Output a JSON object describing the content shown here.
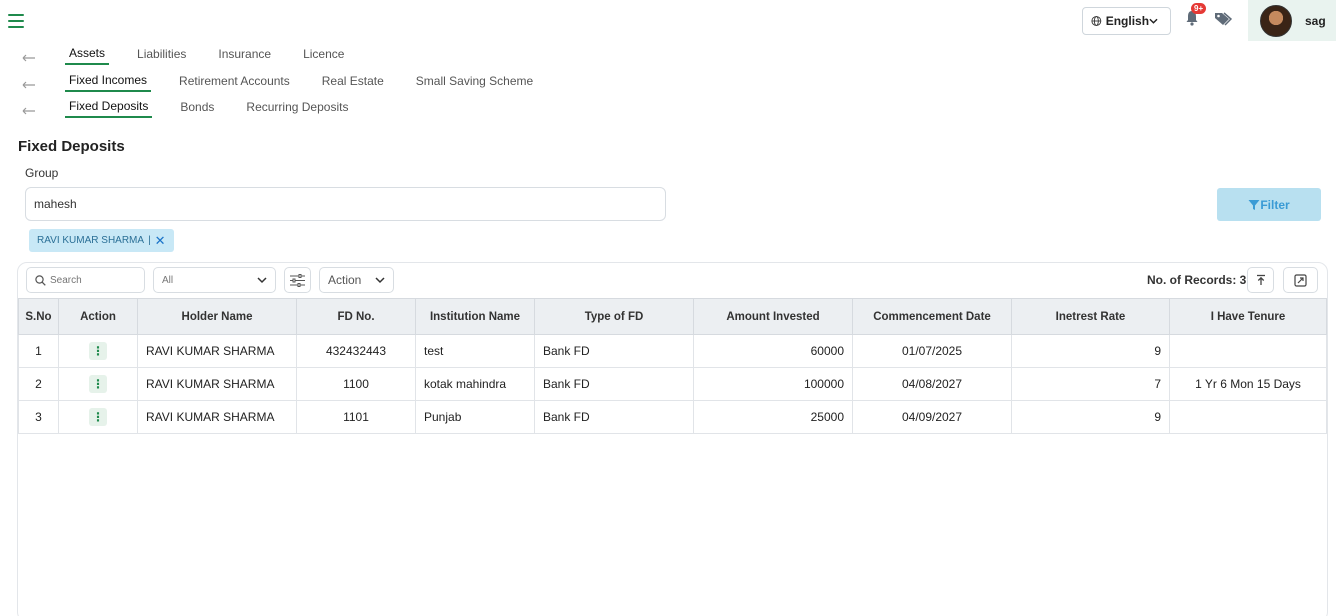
{
  "header": {
    "language": "English",
    "notification_badge": "9+",
    "username": "sag"
  },
  "nav": {
    "row1": [
      {
        "label": "Assets",
        "active": true
      },
      {
        "label": "Liabilities"
      },
      {
        "label": "Insurance"
      },
      {
        "label": "Licence"
      }
    ],
    "row2": [
      {
        "label": "Fixed Incomes",
        "active": true
      },
      {
        "label": "Retirement Accounts"
      },
      {
        "label": "Real Estate"
      },
      {
        "label": "Small Saving Scheme"
      }
    ],
    "row3": [
      {
        "label": "Fixed Deposits",
        "active": true
      },
      {
        "label": "Bonds"
      },
      {
        "label": "Recurring Deposits"
      }
    ]
  },
  "page_title": "Fixed Deposits",
  "group": {
    "label": "Group",
    "value": "mahesh"
  },
  "filter_label": "Filter",
  "chip": {
    "label": "RAVI KUMAR SHARMA",
    "sep": "|"
  },
  "toolbar": {
    "search_placeholder": "Search",
    "select_value": "All",
    "action_label": "Action",
    "records_label": "No. of Records: 3"
  },
  "table": {
    "headers": [
      "S.No",
      "Action",
      "Holder Name",
      "FD No.",
      "Institution Name",
      "Type of FD",
      "Amount Invested",
      "Commencement Date",
      "Inetrest Rate",
      "I Have Tenure"
    ],
    "rows": [
      [
        "1",
        "⋮",
        "RAVI KUMAR SHARMA",
        "432432443",
        "test",
        "Bank FD",
        "60000",
        "01/07/2025",
        "9",
        ""
      ],
      [
        "2",
        "⋮",
        "RAVI KUMAR SHARMA",
        "1100",
        "kotak mahindra",
        "Bank FD",
        "100000",
        "04/08/2027",
        "7",
        "1 Yr 6 Mon 15 Days"
      ],
      [
        "3",
        "⋮",
        "RAVI KUMAR SHARMA",
        "1101",
        "Punjab",
        "Bank FD",
        "25000",
        "04/09/2027",
        "9",
        ""
      ]
    ]
  },
  "colors": {
    "accent": "#1f8a4c",
    "filter_bg": "#b8e0f0",
    "chip_bg": "#c8e8f6",
    "badge": "#e53935"
  }
}
